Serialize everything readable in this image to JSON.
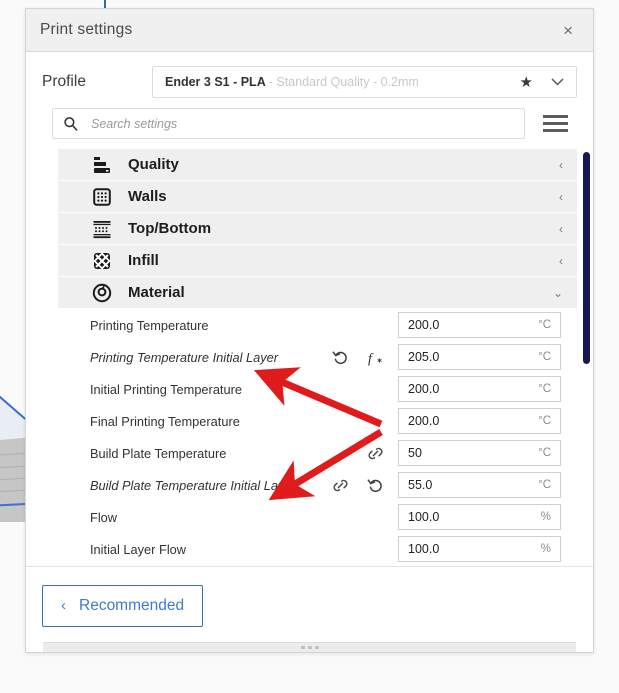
{
  "window": {
    "title": "Print settings",
    "close_icon": "close-icon",
    "close_glyph": "×"
  },
  "profile": {
    "label": "Profile",
    "name": "Ender 3 S1 - PLA",
    "subtitle": " - Standard Quality - 0.2mm",
    "favorite_icon": "star-icon",
    "favorite_glyph": "★",
    "dropdown_icon": "chevron-down-icon",
    "dropdown_glyph": "⌄"
  },
  "search": {
    "placeholder": "Search settings",
    "value": "",
    "icon": "search-icon",
    "menu_icon": "hamburger-menu-icon"
  },
  "categories": [
    {
      "label": "Quality",
      "icon": "quality-icon",
      "expanded": false,
      "chevron": "‹"
    },
    {
      "label": "Walls",
      "icon": "walls-icon",
      "expanded": false,
      "chevron": "‹"
    },
    {
      "label": "Top/Bottom",
      "icon": "top-bottom-icon",
      "expanded": false,
      "chevron": "‹"
    },
    {
      "label": "Infill",
      "icon": "infill-icon",
      "expanded": false,
      "chevron": "‹"
    },
    {
      "label": "Material",
      "icon": "material-icon",
      "expanded": true,
      "chevron": "⌄"
    }
  ],
  "settings": [
    {
      "label": "Printing Temperature",
      "value": "200.0",
      "unit": "°C",
      "modified": false,
      "icons": []
    },
    {
      "label": "Printing Temperature Initial Layer",
      "value": "205.0",
      "unit": "°C",
      "modified": true,
      "icons": [
        "revert-icon",
        "function-icon"
      ]
    },
    {
      "label": "Initial Printing Temperature",
      "value": "200.0",
      "unit": "°C",
      "modified": false,
      "icons": []
    },
    {
      "label": "Final Printing Temperature",
      "value": "200.0",
      "unit": "°C",
      "modified": false,
      "icons": []
    },
    {
      "label": "Build Plate Temperature",
      "value": "50",
      "unit": "°C",
      "modified": false,
      "icons": [
        "link-icon"
      ]
    },
    {
      "label": "Build Plate Temperature Initial Layer",
      "value": "55.0",
      "unit": "°C",
      "modified": true,
      "icons": [
        "link-icon",
        "revert-icon"
      ]
    },
    {
      "label": "Flow",
      "value": "100.0",
      "unit": "%",
      "modified": false,
      "icons": []
    },
    {
      "label": "Initial Layer Flow",
      "value": "100.0",
      "unit": "%",
      "modified": false,
      "icons": []
    }
  ],
  "footer": {
    "recommended_label": "Recommended",
    "back_icon": "chevron-left-icon",
    "back_glyph": "‹",
    "grip_icon": "resize-grip-icon"
  },
  "scrollbar": {
    "icon": "vertical-scrollbar-thumb"
  },
  "annotations": {
    "arrow_color": "#e01b1b",
    "arrows": [
      {
        "name": "arrow-to-printing-temperature-initial-layer",
        "from": [
          381,
          424
        ],
        "to": [
          263,
          374
        ]
      },
      {
        "name": "arrow-to-build-plate-temperature-initial-layer",
        "from": [
          381,
          432
        ],
        "to": [
          277,
          495
        ]
      }
    ]
  },
  "colors": {
    "accent_blue": "#3a7bd5",
    "scrollbar_navy": "#171a52",
    "category_bg": "#efefef",
    "panel_bg": "#ffffff"
  }
}
